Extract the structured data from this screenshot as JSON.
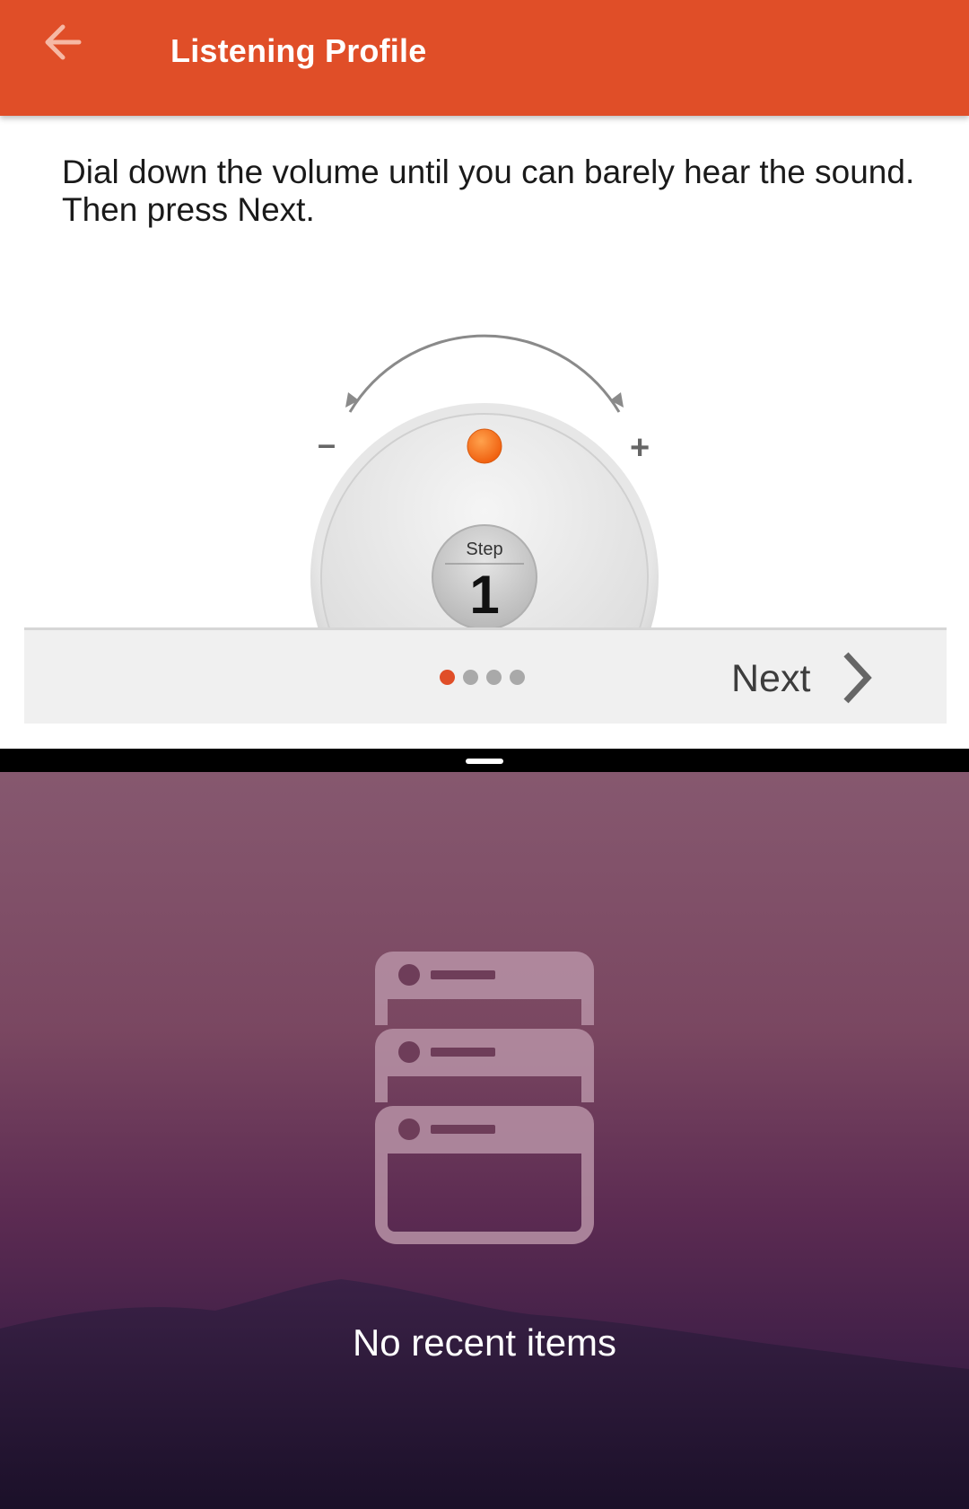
{
  "appbar": {
    "title": "Listening Profile",
    "back_icon": "arrow-left-icon",
    "color": "#e04e28"
  },
  "instruction": "Dial down the volume until you can barely hear the sound. Then press Next.",
  "dial": {
    "minus_symbol": "–",
    "plus_symbol": "+",
    "step_label": "Step",
    "step_number": "1",
    "indicator_color": "#ff7a1f"
  },
  "pager": {
    "page_count": 4,
    "current_page": 1,
    "active_color": "#e04e28",
    "inactive_color": "#a9a9a9"
  },
  "next_button": {
    "label": "Next",
    "icon": "chevron-right-icon"
  },
  "recents": {
    "empty_text": "No recent items",
    "icon": "stacked-windows-icon"
  }
}
